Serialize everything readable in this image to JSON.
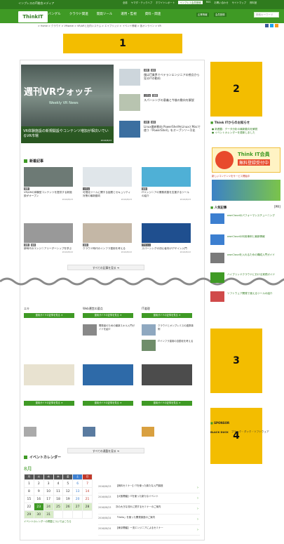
{
  "topbar": {
    "site": "インプレスのIT総合メディア",
    "links": [
      "全誌",
      "ヤマダ・テックハブ",
      "ホワイトレポート",
      "インプレス会員登録",
      "RSS",
      "お問い合わせ",
      "サイトマップ",
      "資料室"
    ]
  },
  "header": {
    "logo": "ThinkIT",
    "nav": [
      "エバンゲル",
      "クラウド関連",
      "開発ツール",
      "運用・監視",
      "資料・関連"
    ],
    "buttons": [
      "企業情報",
      "会員登録"
    ],
    "search_placeholder": "検索キーワード"
  },
  "breadcrumb": "> Home > クラウド > VMware > VR/ARと社内システム > エイブリッジ > イベント情報 > 各オンライン > VR",
  "placeholders": [
    "1",
    "2",
    "3",
    "4"
  ],
  "hero": {
    "logo": "週刊VRウォッチ",
    "sub": "Weekly VR News",
    "caption": "VR体験施設の新規開設やコンテンツ増加が相次いでいるVR市場",
    "date": "2016/8/23"
  },
  "side_articles": [
    {
      "tags": [
        "開発",
        "運用"
      ],
      "text": "僕はIT業界でベテランエンジニアの視点から見るITの動向"
    },
    {
      "tags": [
        "コラム",
        "運用"
      ],
      "text": "スパーシングの意義と今後の動向を解説"
    },
    {
      "tags": [
        "開発",
        "運用"
      ],
      "text": "Linux最新動向 PowerShellをLinuxとMacで使う「PowerShell」をオープンソース化"
    }
  ],
  "latest": {
    "title": "新着記事",
    "items": [
      {
        "tags": [
          "開発"
        ],
        "text": "VR/ARの体験型コンテンツを提供する新施設がオープン",
        "date": "2016/8/23"
      },
      {
        "tags": [
          "コラム"
        ],
        "text": "可視化ツールに関する話題とセキュリティ対策の最新動向",
        "date": "2016/8/23"
      },
      {
        "tags": [
          "運用"
        ],
        "text": "ITエンジニアの業務改善を支援するツールの紹介",
        "date": "2016/8/23"
      },
      {
        "tags": [
          "開発",
          "運用"
        ],
        "text": "新時代のエンジニアリーダーシップを学ぶ",
        "date": "2016/8/22"
      },
      {
        "tags": [
          "運用"
        ],
        "text": "クラウド時代のインフラ運用を考える",
        "date": "2016/8/22"
      },
      {
        "tags": [
          "デザイン"
        ],
        "text": "スパーシングの初心者向けデザイン入門",
        "date": "2016/8/22"
      }
    ],
    "more": "すべての記事を見る ➔"
  },
  "lower": {
    "col_heads": [
      "エキ",
      "Web運営の要点",
      "IT道理"
    ],
    "more_btn": "運用ガイドの記事を見る ➔",
    "more_all": "すべての連載を見る ➔",
    "mid_texts": [
      "開発者のための最新スキル入門ガイドを紹介",
      "クラウドとオンプレミスの連携事例",
      "ITインフラ運用の自動化を考える"
    ]
  },
  "right": {
    "notice_title": "Think ITからのお知らせ",
    "notices": [
      "● 新連載：データ分析の最新動向を解説",
      "● イベントカレンダーを更新しました"
    ],
    "member_title": "Think IT会員",
    "member_sub": "無料登録受付中",
    "member_link": "新しいコンテンツをサービス開始中",
    "ranking_title": "人気記事",
    "ranking_badge": "[PR]",
    "ads": [
      "ownCloudのパフォーマンスチューニング",
      "ownCloudの利用事例と最新情報",
      "ownCloudを入れるための構成入門ガイド",
      "ハイブリッドクラウドにおける実践ガイド",
      "ソフトウェア開発で使えるツールの紹介"
    ],
    "sponsor_title": "SPONSOR",
    "sponsor_name": "BLACK DUCK",
    "sponsor_text": "ブラック・ダック・ソフトウェア"
  },
  "calendar": {
    "title": "イベントカレンダー",
    "month": "8月",
    "days": [
      "月",
      "火",
      "水",
      "木",
      "金",
      "土",
      "日"
    ],
    "footer": "イベントカレンダーの掲載についてはこちら"
  },
  "events": [
    {
      "date": "2016/08/23",
      "text": "【無料セミナー】ITを使った新たな入門講座"
    },
    {
      "date": "2016/08/23",
      "text": "【大阪開催】ITを使った新たなイベント"
    },
    {
      "date": "2016/08/23",
      "text": "次の大きな流れに関するセミナーのご案内"
    },
    {
      "date": "2016/08/24",
      "text": "「Hello」を使った開発講座のご案内"
    },
    {
      "date": "2016/08/24",
      "text": "【東京開催】一流エンジニアによるセミナー"
    }
  ],
  "colors": {
    "brand": "#3f9a25",
    "dark": "#2f7b1e",
    "placeholder": "#f3bd00"
  }
}
